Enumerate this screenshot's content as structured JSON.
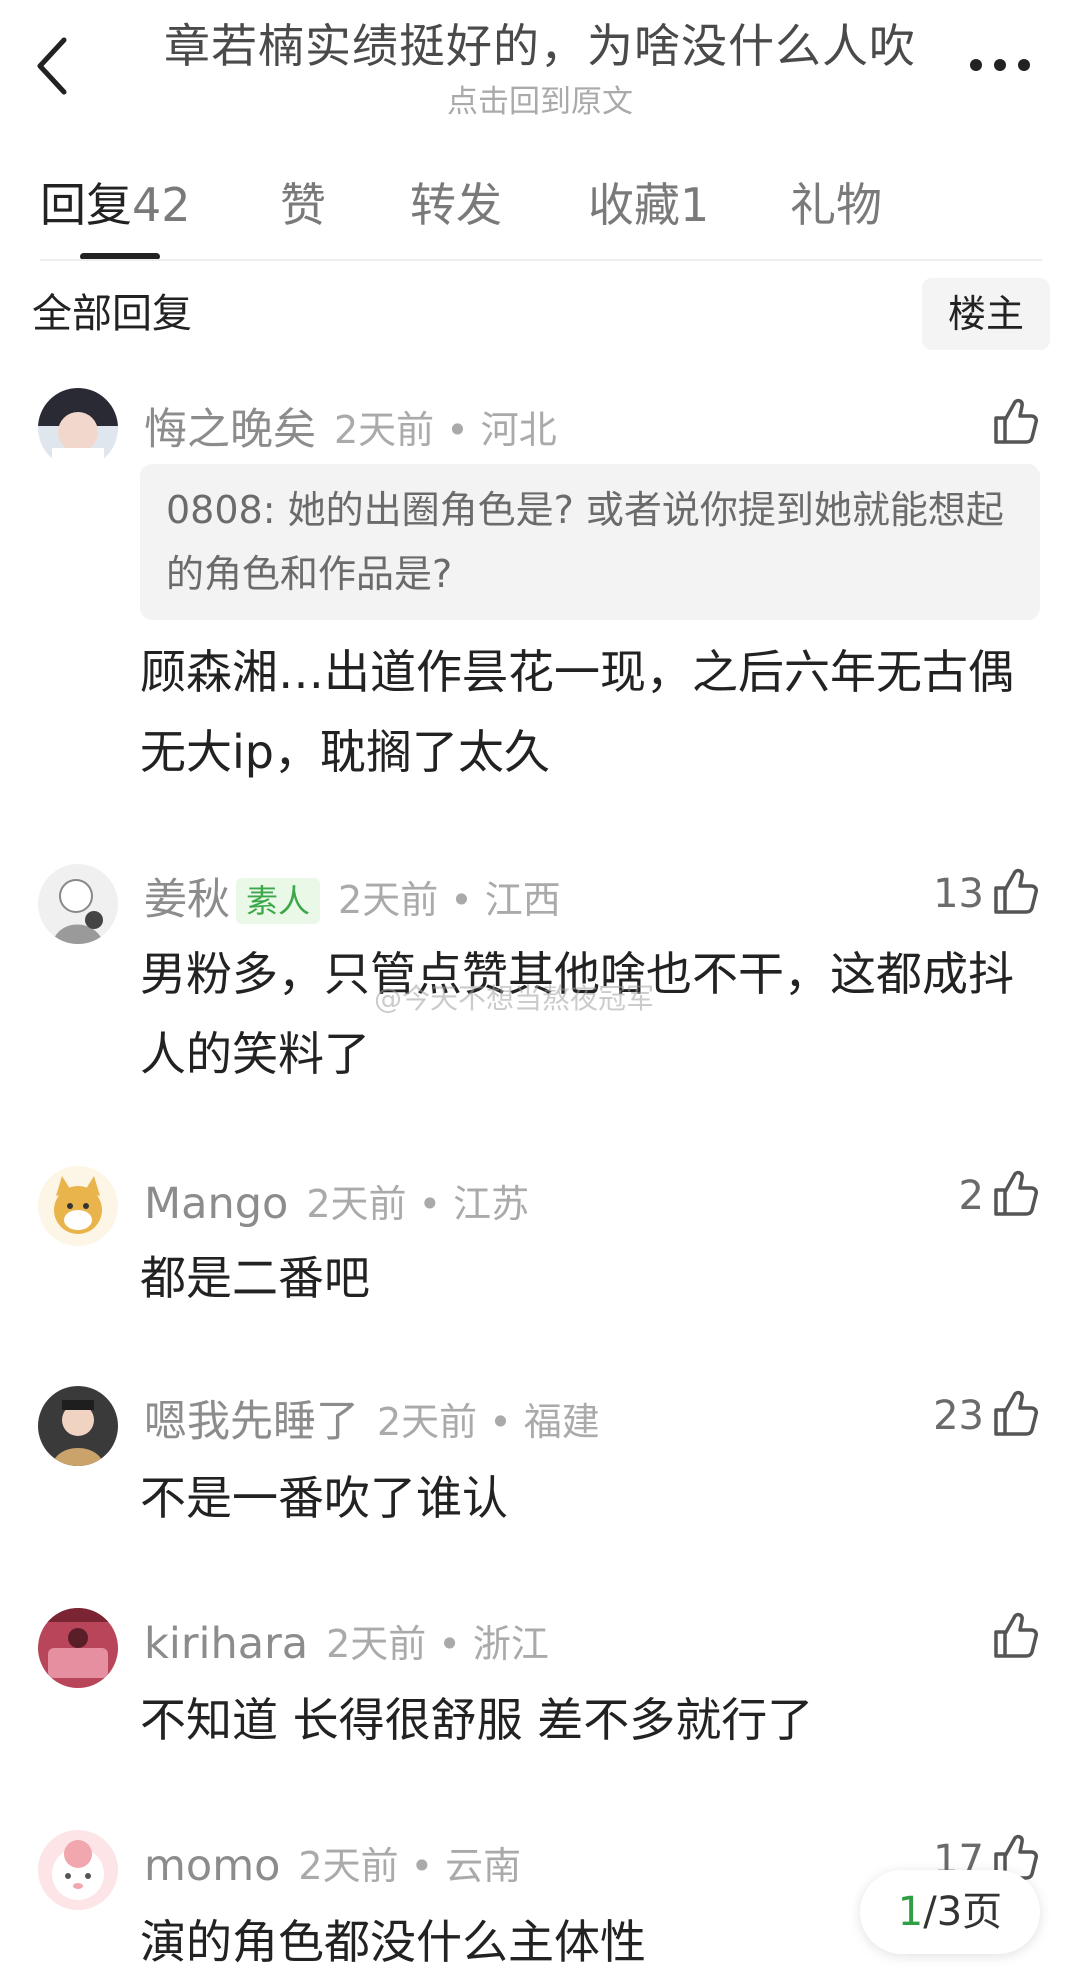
{
  "header": {
    "title": "章若楠实绩挺好的，为啥没什么人吹",
    "subtitle": "点击回到原文"
  },
  "tabs": [
    {
      "label": "回复",
      "count": "42",
      "active": true
    },
    {
      "label": "赞",
      "count": ""
    },
    {
      "label": "转发",
      "count": ""
    },
    {
      "label": "收藏",
      "count": "1"
    },
    {
      "label": "礼物",
      "count": ""
    }
  ],
  "filter": {
    "all_label": "全部回复",
    "op_label": "楼主"
  },
  "comments": [
    {
      "username": "悔之晚矣",
      "badge": "",
      "time": "2天前",
      "location": "河北",
      "likes": "",
      "quote": "0808: 她的出圈角色是? 或者说你提到她就能想起的角色和作品是?",
      "content": "顾森湘…出道作昙花一现，之后六年无古偶无大ip，耽搁了太久"
    },
    {
      "username": "姜秋",
      "badge": "素人",
      "time": "2天前",
      "location": "江西",
      "likes": "13",
      "quote": "",
      "content": "男粉多，只管点赞其他啥也不干，这都成抖人的笑料了"
    },
    {
      "username": "Mango",
      "badge": "",
      "time": "2天前",
      "location": "江苏",
      "likes": "2",
      "quote": "",
      "content": "都是二番吧"
    },
    {
      "username": "嗯我先睡了",
      "badge": "",
      "time": "2天前",
      "location": "福建",
      "likes": "23",
      "quote": "",
      "content": "不是一番吹了谁认"
    },
    {
      "username": "kirihara",
      "badge": "",
      "time": "2天前",
      "location": "浙江",
      "likes": "",
      "quote": "",
      "content": "不知道 长得很舒服 差不多就行了"
    },
    {
      "username": "momo",
      "badge": "",
      "time": "2天前",
      "location": "云南",
      "likes": "17",
      "quote": "",
      "content": "演的角色都没什么主体性"
    }
  ],
  "watermark": "@今天不想当熬夜冠军",
  "pagination": {
    "current": "1",
    "total_text": "/3页"
  },
  "colors": {
    "text": "#222222",
    "meta": "#8c8c8c",
    "badge_bg": "#eaf8e8",
    "badge_text": "#3ca84a",
    "page_current": "#2ea043"
  }
}
